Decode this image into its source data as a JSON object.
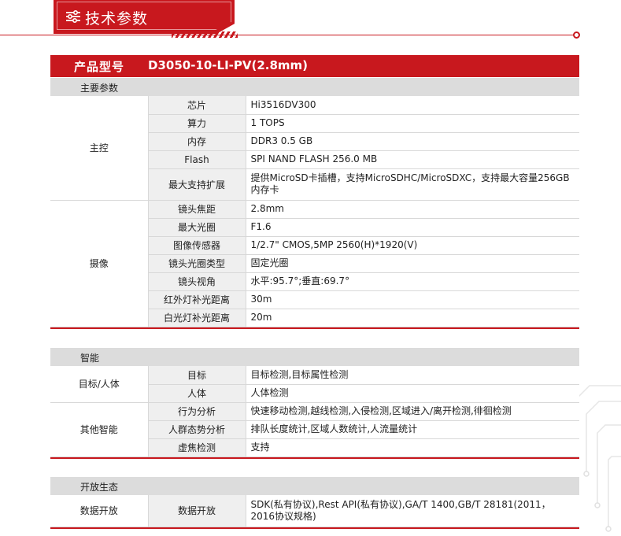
{
  "header": {
    "title": "技术参数",
    "icon": "sliders-icon"
  },
  "product": {
    "label": "产品型号",
    "model": "D3050-10-LI-PV(2.8mm)"
  },
  "sections": [
    {
      "title": "主要参数",
      "groups": [
        {
          "name": "主控",
          "rows": [
            {
              "key": "芯片",
              "value": "Hi3516DV300"
            },
            {
              "key": "算力",
              "value": "1 TOPS"
            },
            {
              "key": "内存",
              "value": "DDR3 0.5 GB"
            },
            {
              "key": "Flash",
              "value": "SPI NAND FLASH 256.0 MB"
            },
            {
              "key": "最大支持扩展",
              "value": "提供MicroSD卡插槽，支持MicroSDHC/MicroSDXC，支持最大容量256GB内存卡"
            }
          ]
        },
        {
          "name": "摄像",
          "rows": [
            {
              "key": "镜头焦距",
              "value": "2.8mm"
            },
            {
              "key": "最大光圈",
              "value": "F1.6"
            },
            {
              "key": "图像传感器",
              "value": "1/2.7\" CMOS,5MP 2560(H)*1920(V)"
            },
            {
              "key": "镜头光圈类型",
              "value": "固定光圈"
            },
            {
              "key": "镜头视角",
              "value": "水平:95.7°;垂直:69.7°"
            },
            {
              "key": "红外灯补光距离",
              "value": "30m"
            },
            {
              "key": "白光灯补光距离",
              "value": "20m"
            }
          ]
        }
      ]
    },
    {
      "title": "智能",
      "groups": [
        {
          "name": "目标/人体",
          "rows": [
            {
              "key": "目标",
              "value": "目标检测,目标属性检测"
            },
            {
              "key": "人体",
              "value": "人体检测"
            }
          ]
        },
        {
          "name": "其他智能",
          "rows": [
            {
              "key": "行为分析",
              "value": "快速移动检测,越线检测,入侵检测,区域进入/离开检测,徘徊检测"
            },
            {
              "key": "人群态势分析",
              "value": "排队长度统计,区域人数统计,人流量统计"
            },
            {
              "key": "虚焦检测",
              "value": "支持"
            }
          ]
        }
      ]
    },
    {
      "title": "开放生态",
      "groups": [
        {
          "name": "数据开放",
          "rows": [
            {
              "key": "数据开放",
              "value": "SDK(私有协议),Rest API(私有协议),GA/T 1400,GB/T 28181(2011，2016协议规格)"
            }
          ]
        }
      ]
    }
  ]
}
